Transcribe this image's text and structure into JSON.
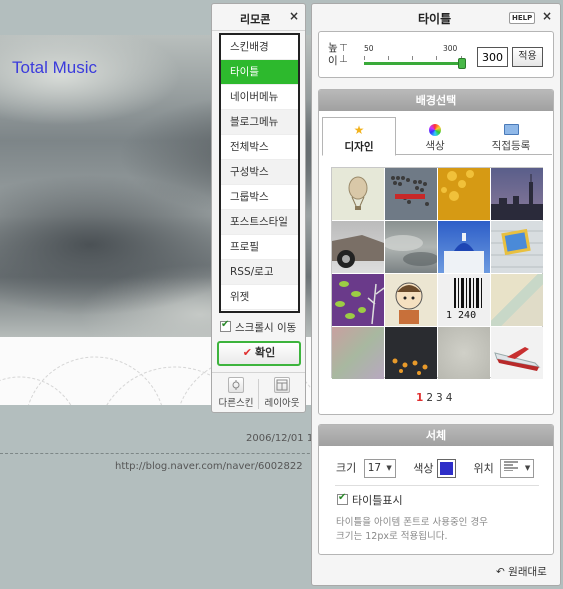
{
  "blog": {
    "title": "Total Music",
    "date": "2006/12/01 1",
    "url": "http://blog.naver.com/naver/6002822"
  },
  "remote": {
    "title": "리모콘",
    "close": "×",
    "menu": [
      "스킨배경",
      "타이틀",
      "네이버메뉴",
      "블로그메뉴",
      "전체박스",
      "구성박스",
      "그룹박스",
      "포스트스타일",
      "프로필",
      "RSS/로고",
      "위젯"
    ],
    "active_index": 1,
    "scroll_label": "스크롤시 이동",
    "scroll_checked": true,
    "confirm_label": "확인",
    "other_skin": "다른스킨",
    "layout": "레이아웃"
  },
  "title_panel": {
    "title": "타이틀",
    "help": "HELP",
    "close": "×",
    "height_label": "높이",
    "slider_min": "50",
    "slider_max": "300",
    "height_value": "300",
    "apply_label": "적용"
  },
  "background": {
    "header": "배경선택",
    "tabs": [
      "디자인",
      "색상",
      "직접등록"
    ],
    "active_tab": 0,
    "pages": [
      "1",
      "2",
      "3",
      "4"
    ],
    "current_page": 0
  },
  "font": {
    "header": "서체",
    "size_label": "크기",
    "size_value": "17",
    "color_label": "색상",
    "color_value": "#2e2ec8",
    "position_label": "위치",
    "show_title_label": "타이틀표시",
    "show_title_checked": true,
    "note_line1": "타이틀을 아이템 폰트로 사용중인 경우",
    "note_line2": "크기는 12px로 적용됩니다."
  },
  "reset_label": "원래대로",
  "colors": {
    "active_green": "#2db92d",
    "blog_title_blue": "#3b3bdc",
    "page_current_red": "#e03030"
  }
}
